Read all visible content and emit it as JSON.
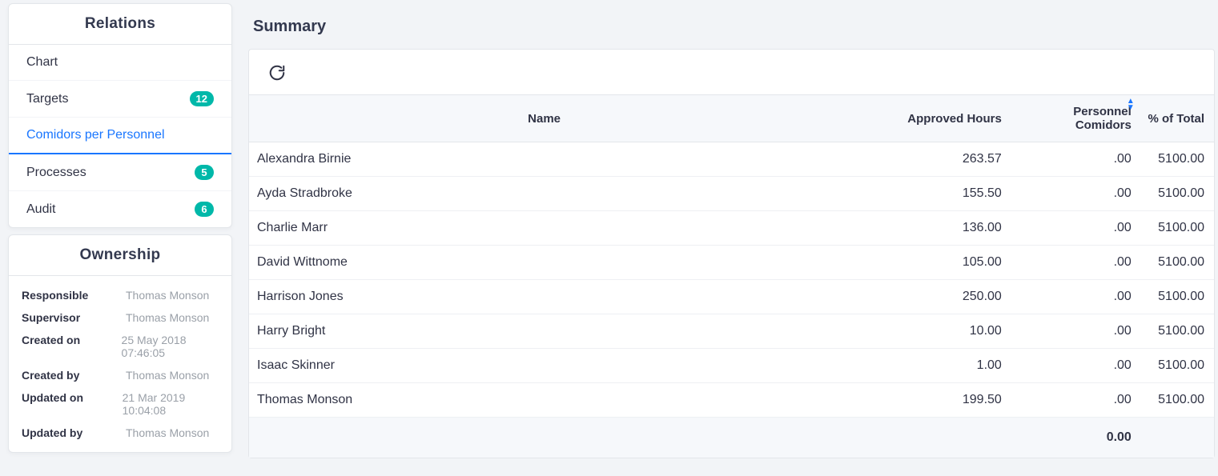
{
  "sidebar": {
    "relations": {
      "title": "Relations",
      "items": [
        {
          "label": "Chart",
          "badge": ""
        },
        {
          "label": "Targets",
          "badge": "12"
        },
        {
          "label": "Comidors per Personnel",
          "badge": ""
        },
        {
          "label": "Processes",
          "badge": "5"
        },
        {
          "label": "Audit",
          "badge": "6"
        }
      ],
      "active_index": 2
    },
    "ownership": {
      "title": "Ownership",
      "rows": [
        {
          "label": "Responsible",
          "value": "Thomas Monson"
        },
        {
          "label": "Supervisor",
          "value": "Thomas Monson"
        },
        {
          "label": "Created on",
          "value": "25 May 2018 07:46:05"
        },
        {
          "label": "Created by",
          "value": "Thomas Monson"
        },
        {
          "label": "Updated on",
          "value": "21 Mar 2019 10:04:08"
        },
        {
          "label": "Updated by",
          "value": "Thomas Monson"
        }
      ]
    }
  },
  "main": {
    "title": "Summary",
    "refresh_icon": "refresh",
    "table": {
      "columns": [
        "Name",
        "Approved Hours",
        "Personnel Comidors",
        "% of Total"
      ],
      "sorted_column_index": 2,
      "rows": [
        {
          "name": "Alexandra Birnie",
          "approved": "263.57",
          "comidors": ".00",
          "pct": "5100.00"
        },
        {
          "name": "Ayda Stradbroke",
          "approved": "155.50",
          "comidors": ".00",
          "pct": "5100.00"
        },
        {
          "name": "Charlie Marr",
          "approved": "136.00",
          "comidors": ".00",
          "pct": "5100.00"
        },
        {
          "name": "David Wittnome",
          "approved": "105.00",
          "comidors": ".00",
          "pct": "5100.00"
        },
        {
          "name": "Harrison Jones",
          "approved": "250.00",
          "comidors": ".00",
          "pct": "5100.00"
        },
        {
          "name": "Harry Bright",
          "approved": "10.00",
          "comidors": ".00",
          "pct": "5100.00"
        },
        {
          "name": "Isaac Skinner",
          "approved": "1.00",
          "comidors": ".00",
          "pct": "5100.00"
        },
        {
          "name": "Thomas Monson",
          "approved": "199.50",
          "comidors": ".00",
          "pct": "5100.00"
        }
      ],
      "footer_total": "0.00"
    }
  }
}
